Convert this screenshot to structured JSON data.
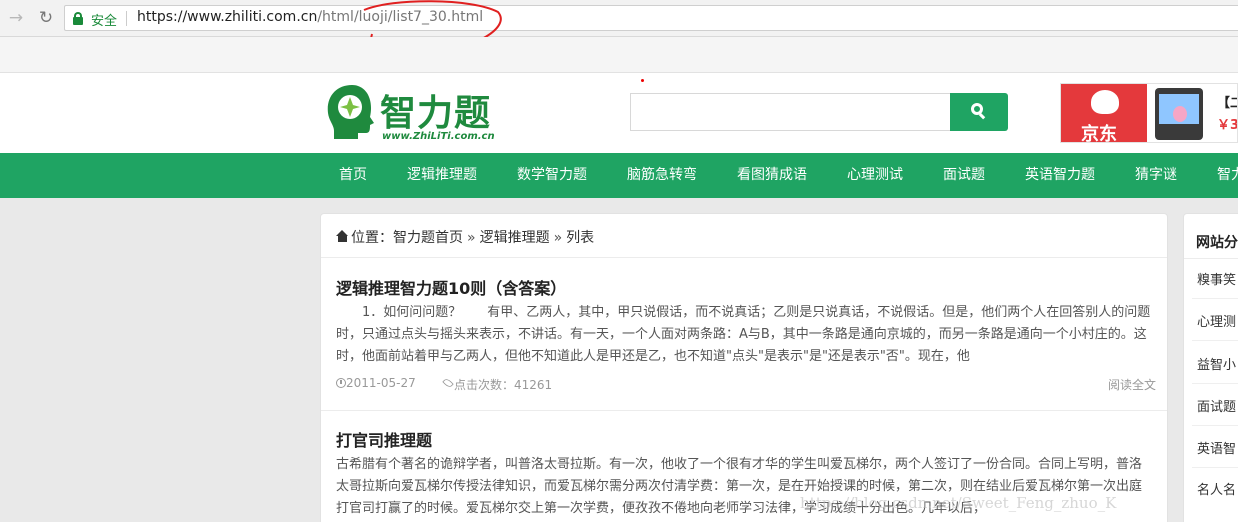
{
  "browser": {
    "secure_label": "安全",
    "url_scheme_host": "https://www.zhiliti.com.cn",
    "url_path": "/html/luoji/list7_30.html"
  },
  "header": {
    "logo_text": "智力题",
    "logo_sub": "www.ZhiLiTi.com.cn",
    "search_placeholder": "",
    "ad": {
      "brand": "京东",
      "text": "【二",
      "price": "￥3"
    }
  },
  "nav": {
    "items": [
      {
        "label": "首页"
      },
      {
        "label": "逻辑推理题"
      },
      {
        "label": "数学智力题"
      },
      {
        "label": "脑筋急转弯"
      },
      {
        "label": "看图猜成语"
      },
      {
        "label": "心理测试"
      },
      {
        "label": "面试题"
      },
      {
        "label": "英语智力题"
      },
      {
        "label": "猜字谜"
      },
      {
        "label": "智力"
      }
    ]
  },
  "breadcrumb": {
    "prefix": "位置：",
    "home": "智力题首页",
    "sep1": "»",
    "category": "逻辑推理题",
    "sep2": "»",
    "current": "列表"
  },
  "articles": [
    {
      "title": "逻辑推理智力题10则（含答案）",
      "summary": "　　1．如何问问题？　　有甲、乙两人，其中，甲只说假话，而不说真话；乙则是只说真话，不说假话。但是，他们两个人在回答别人的问题时，只通过点头与摇头来表示，不讲话。有一天，一个人面对两条路：A与B，其中一条路是通向京城的，而另一条路是通向一个小村庄的。这时，他面前站着甲与乙两人，但他不知道此人是甲还是乙，也不知道\"点头\"是表示\"是\"还是表示\"否\"。现在，他",
      "date": "2011-05-27",
      "views": "点击次数：41261",
      "read_more": "阅读全文"
    },
    {
      "title": "打官司推理题",
      "summary": "古希腊有个著名的诡辩学者，叫普洛太哥拉斯。有一次，他收了一个很有才华的学生叫爱瓦梯尔，两个人签订了一份合同。合同上写明，普洛太哥拉斯向爱瓦梯尔传授法律知识，而爱瓦梯尔需分两次付清学费：第一次，是在开始授课的时候，第二次，则在结业后爱瓦梯尔第一次出庭打官司打赢了的时候。爱瓦梯尔交上第一次学费，便孜孜不倦地向老师学习法律，学习成绩十分出色。几年以后，"
    }
  ],
  "sidebar": {
    "title": "网站分",
    "items": [
      "糗事笑",
      "心理测",
      "益智小",
      "面试题",
      "英语智",
      "名人名"
    ]
  },
  "watermark": "https://blog.csdn.net/Sweet_Feng_zhuo_K"
}
